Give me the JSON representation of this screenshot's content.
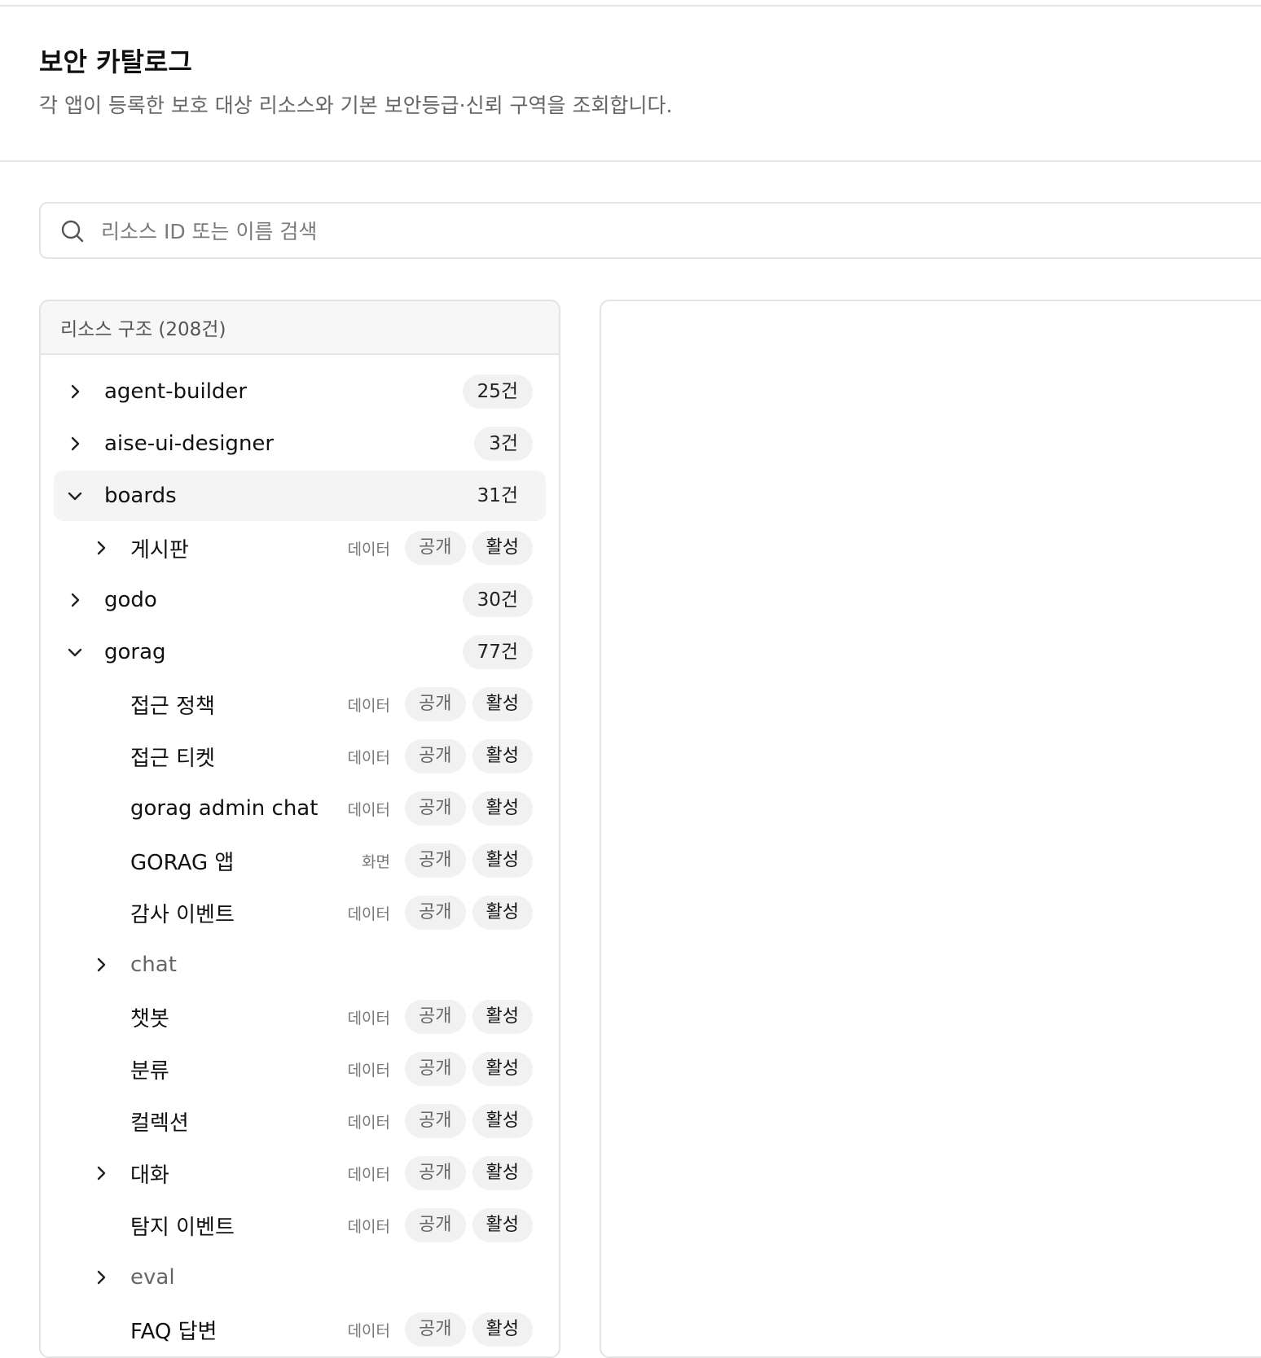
{
  "header": {
    "title": "보안 카탈로그",
    "subtitle": "각 앱이 등록한 보호 대상 리소스와 기본 보안등급·신뢰 구역을 조회합니다."
  },
  "search": {
    "placeholder": "리소스 ID 또는 이름 검색",
    "value": ""
  },
  "tree": {
    "header": "리소스 구조 (208건)",
    "rows": [
      {
        "label": "agent-builder",
        "count": "25건"
      },
      {
        "label": "aise-ui-designer",
        "count": "3건"
      },
      {
        "label": "boards",
        "count": "31건"
      },
      {
        "label": "게시판",
        "type": "데이터",
        "visibility": "공개",
        "status": "활성"
      },
      {
        "label": "godo",
        "count": "30건"
      },
      {
        "label": "gorag",
        "count": "77건"
      },
      {
        "label": "접근 정책",
        "type": "데이터",
        "visibility": "공개",
        "status": "활성"
      },
      {
        "label": "접근 티켓",
        "type": "데이터",
        "visibility": "공개",
        "status": "활성"
      },
      {
        "label": "gorag admin chat",
        "type": "데이터",
        "visibility": "공개",
        "status": "활성"
      },
      {
        "label": "GORAG 앱",
        "type": "화면",
        "visibility": "공개",
        "status": "활성"
      },
      {
        "label": "감사 이벤트",
        "type": "데이터",
        "visibility": "공개",
        "status": "활성"
      },
      {
        "label": "chat"
      },
      {
        "label": "챗봇",
        "type": "데이터",
        "visibility": "공개",
        "status": "활성"
      },
      {
        "label": "분류",
        "type": "데이터",
        "visibility": "공개",
        "status": "활성"
      },
      {
        "label": "컬렉션",
        "type": "데이터",
        "visibility": "공개",
        "status": "활성"
      },
      {
        "label": "대화",
        "type": "데이터",
        "visibility": "공개",
        "status": "활성"
      },
      {
        "label": "탐지 이벤트",
        "type": "데이터",
        "visibility": "공개",
        "status": "활성"
      },
      {
        "label": "eval"
      },
      {
        "label": "FAQ 답변",
        "type": "데이터",
        "visibility": "공개",
        "status": "활성"
      }
    ]
  },
  "icons": {
    "search": "search-icon",
    "collapsed": "chevron-right-icon",
    "expanded": "chevron-down-icon"
  }
}
